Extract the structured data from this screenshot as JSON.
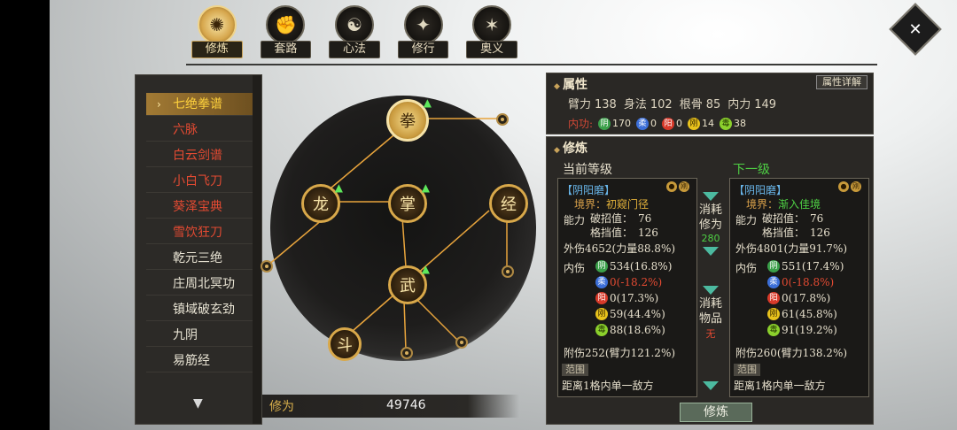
{
  "top_nav": {
    "tabs": [
      {
        "label": "修炼",
        "icon": "flame-lotus-icon",
        "active": true
      },
      {
        "label": "套路",
        "icon": "fist-icon",
        "active": false
      },
      {
        "label": "心法",
        "icon": "swirl-icon",
        "active": false
      },
      {
        "label": "修行",
        "icon": "pose-icon",
        "active": false
      },
      {
        "label": "奥义",
        "icon": "sword-emblem-icon",
        "active": false
      }
    ]
  },
  "skills": [
    {
      "label": "七绝拳谱",
      "color": "red",
      "selected": true
    },
    {
      "label": "六脉",
      "color": "red"
    },
    {
      "label": "白云剑谱",
      "color": "red"
    },
    {
      "label": "小白飞刀",
      "color": "red"
    },
    {
      "label": "葵泽宝典",
      "color": "red"
    },
    {
      "label": "雪饮狂刀",
      "color": "red"
    },
    {
      "label": "乾元三绝",
      "color": "white"
    },
    {
      "label": "庄周北冥功",
      "color": "white"
    },
    {
      "label": "镇域破玄劲",
      "color": "white"
    },
    {
      "label": "九阴",
      "color": "white"
    },
    {
      "label": "易筋经",
      "color": "white"
    }
  ],
  "cultivation_points": {
    "label": "修为",
    "value": "49746"
  },
  "attributes": {
    "title": "属性",
    "detail_button": "属性详解",
    "stats": [
      {
        "label": "臂力",
        "value": "138"
      },
      {
        "label": "身法",
        "value": "102"
      },
      {
        "label": "根骨",
        "value": "85"
      },
      {
        "label": "内力",
        "value": "149"
      }
    ],
    "inner_label": "内功:",
    "inner": [
      {
        "name": "阴",
        "value": "170",
        "color": "#3ba04a"
      },
      {
        "name": "柔",
        "value": "0",
        "color": "#3c6fd8"
      },
      {
        "name": "阳",
        "value": "0",
        "color": "#d83a2a"
      },
      {
        "name": "刚",
        "value": "14",
        "color": "#e8c21c"
      },
      {
        "name": "毒",
        "value": "38",
        "color": "#8bd02c"
      }
    ]
  },
  "training": {
    "title": "修炼",
    "current_header": "当前等级",
    "next_header": "下一级",
    "cost_label": "消耗修为",
    "cost_value": "280",
    "item_label": "消耗物品",
    "item_mark": "无",
    "button": "修炼",
    "current": {
      "name": "【阴阳磨】",
      "tag": "刚",
      "realm_label": "境界：",
      "realm_value": "初窥门径",
      "ability_label": "能力",
      "break_label": "破招值：",
      "break_value": "76",
      "block_label": "格挡值：",
      "block_value": "126",
      "outer": "外伤4652(力量88.8%)",
      "inner_label": "内伤",
      "inner": [
        {
          "name": "阴",
          "text": "534(16.8%)",
          "style": "normal"
        },
        {
          "name": "柔",
          "text": "0(-18.2%)",
          "style": "red"
        },
        {
          "name": "阳",
          "text": "0(17.3%)",
          "style": "normal"
        },
        {
          "name": "刚",
          "text": "59(44.4%)",
          "style": "normal"
        },
        {
          "name": "毒",
          "text": "88(18.6%)",
          "style": "normal"
        }
      ],
      "attached": "附伤252(臂力121.2%)",
      "range_label": "范围",
      "range_text": "距离1格内单一敌方"
    },
    "next": {
      "name": "【阴阳磨】",
      "tag": "刚",
      "realm_label": "境界：",
      "realm_value": "渐入佳境",
      "ability_label": "能力",
      "break_label": "破招值：",
      "break_value": "76",
      "block_label": "格挡值：",
      "block_value": "126",
      "outer": "外伤4801(力量91.7%)",
      "inner_label": "内伤",
      "inner": [
        {
          "name": "阴",
          "text": "551(17.4%)",
          "style": "normal"
        },
        {
          "name": "柔",
          "text": "0(-18.8%)",
          "style": "red"
        },
        {
          "name": "阳",
          "text": "0(17.8%)",
          "style": "normal"
        },
        {
          "name": "刚",
          "text": "61(45.8%)",
          "style": "normal"
        },
        {
          "name": "毒",
          "text": "91(19.2%)",
          "style": "normal"
        }
      ],
      "attached": "附伤260(臂力138.2%)",
      "range_label": "范围",
      "range_text": "距离1格内单一敌方"
    }
  },
  "tree": {
    "nodes": [
      {
        "name": "top-node",
        "glyph": "拳",
        "upgradable": true
      },
      {
        "name": "left-node",
        "glyph": "龙",
        "upgradable": true
      },
      {
        "name": "center-node",
        "glyph": "掌",
        "upgradable": true
      },
      {
        "name": "right-node",
        "glyph": "经",
        "upgradable": false
      },
      {
        "name": "lower-node",
        "glyph": "武",
        "upgradable": true
      },
      {
        "name": "bottom-left-node",
        "glyph": "斗",
        "upgradable": false
      }
    ]
  }
}
